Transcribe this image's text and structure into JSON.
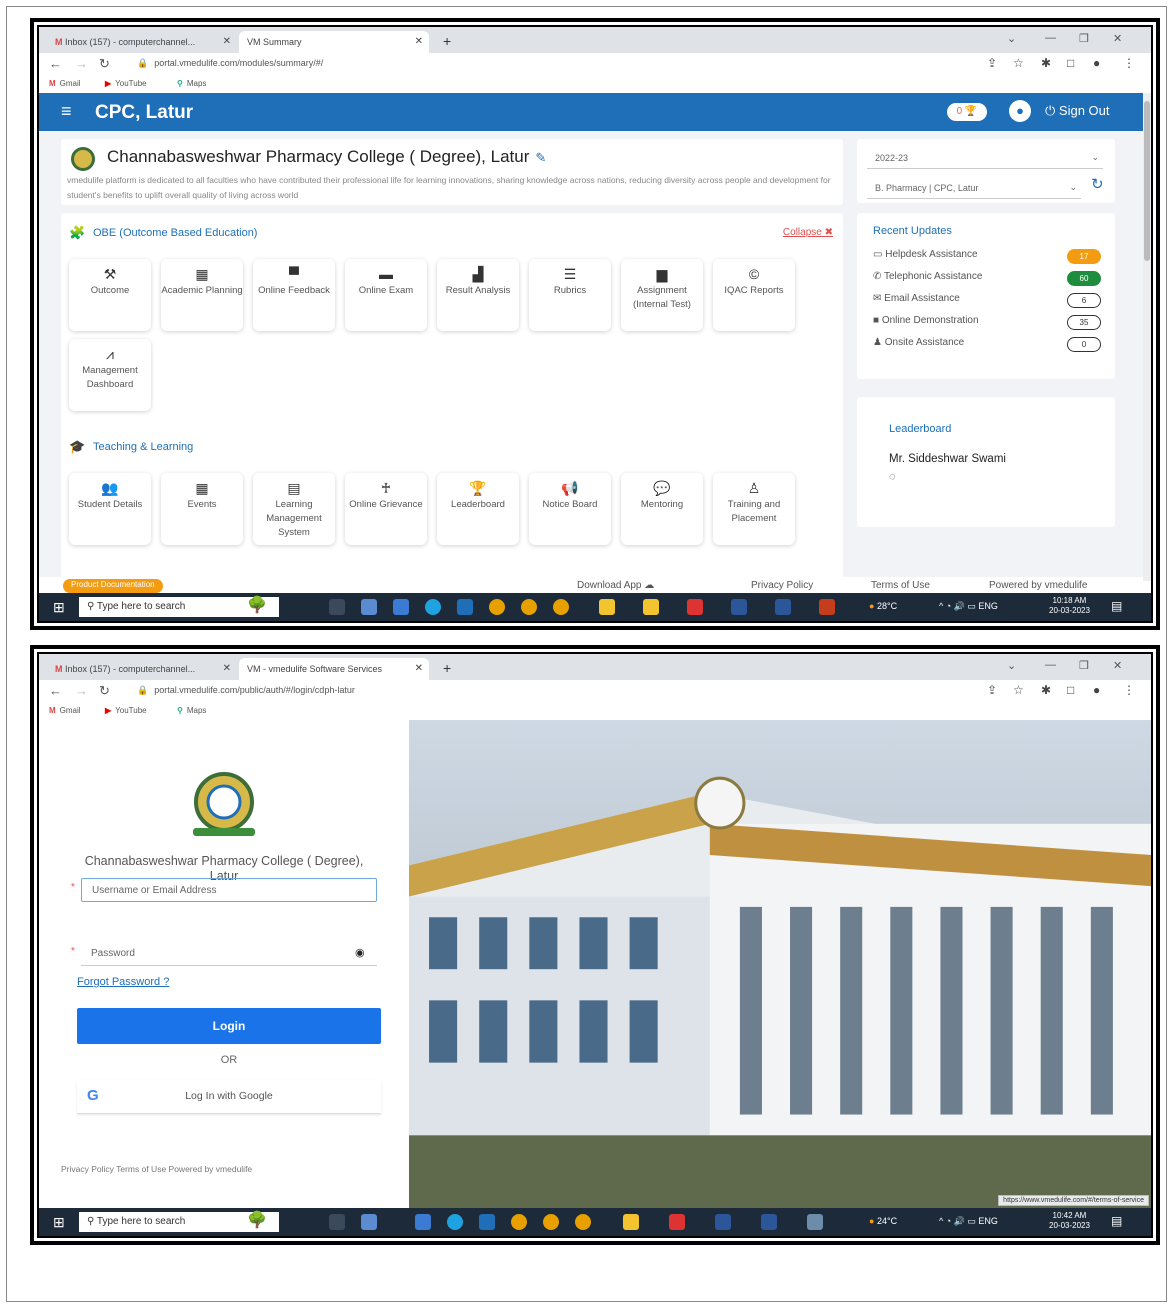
{
  "shot1": {
    "tabs": [
      {
        "label": "Inbox (157) - computerchannel..."
      },
      {
        "label": "VM Summary"
      }
    ],
    "url": "portal.vmedulife.com/modules/summary/#/",
    "bookmarks": [
      "Gmail",
      "YouTube",
      "Maps"
    ],
    "app_title": "CPC, Latur",
    "trophy_count": "0",
    "sign_out": "Sign Out",
    "college_name": "Channabasweshwar Pharmacy College ( Degree), Latur",
    "college_desc": "vmedulife platform is dedicated to all faculties who have contributed their professional life for learning innovations, sharing knowledge across nations, reducing diversity across people and development for student's benefits to uplift overall quality of living across world",
    "year_select": "2022-23",
    "program_select": "B. Pharmacy | CPC, Latur",
    "obe_title": "OBE (Outcome Based Education)",
    "collapse_label": "Collapse",
    "obe_tiles": [
      {
        "label": "Outcome",
        "icon": "wrench-icon"
      },
      {
        "label": "Academic Planning",
        "icon": "calendar-icon"
      },
      {
        "label": "Online Feedback",
        "icon": "chat-icon"
      },
      {
        "label": "Online Exam",
        "icon": "folder-icon"
      },
      {
        "label": "Result Analysis",
        "icon": "bar-chart-icon"
      },
      {
        "label": "Rubrics",
        "icon": "list-icon"
      },
      {
        "label": "Assignment (Internal Test)",
        "icon": "document-icon"
      },
      {
        "label": "IQAC Reports",
        "icon": "copyright-icon"
      },
      {
        "label": "Management Dashboard",
        "icon": "line-chart-icon"
      }
    ],
    "teaching_title": "Teaching & Learning",
    "teaching_tiles": [
      {
        "label": "Student Details",
        "icon": "users-icon"
      },
      {
        "label": "Events",
        "icon": "calendar-icon"
      },
      {
        "label": "Learning Management System",
        "icon": "book-icon"
      },
      {
        "label": "Online Grievance",
        "icon": "person-icon"
      },
      {
        "label": "Leaderboard",
        "icon": "trophy-icon"
      },
      {
        "label": "Notice Board",
        "icon": "megaphone-icon"
      },
      {
        "label": "Mentoring",
        "icon": "chat-icon"
      },
      {
        "label": "Training and Placement",
        "icon": "person-board-icon"
      }
    ],
    "updates_title": "Recent Updates",
    "updates": [
      {
        "label": "Helpdesk Assistance",
        "count": "17",
        "style": "orange"
      },
      {
        "label": "Telephonic Assistance",
        "count": "60",
        "style": "green"
      },
      {
        "label": "Email Assistance",
        "count": "6",
        "style": "outline"
      },
      {
        "label": "Online Demonstration",
        "count": "35",
        "style": "outline"
      },
      {
        "label": "Onsite Assistance",
        "count": "0",
        "style": "outline"
      }
    ],
    "leaderboard_title": "Leaderboard",
    "leaderboard_name": "Mr. Siddeshwar Swami",
    "footer": {
      "product_doc": "Product Documentation",
      "download": "Download App",
      "privacy": "Privacy Policy",
      "terms": "Terms of Use",
      "powered": "Powered by vmedulife"
    },
    "taskbar": {
      "search": "Type here to search",
      "weather": "28°C",
      "lang": "ENG",
      "time": "10:18 AM",
      "date": "20-03-2023"
    }
  },
  "shot2": {
    "tabs": [
      {
        "label": "Inbox (157) - computerchannel..."
      },
      {
        "label": "VM - vmedulife Software Services"
      }
    ],
    "url": "portal.vmedulife.com/public/auth/#/login/cdph-latur",
    "bookmarks": [
      "Gmail",
      "YouTube",
      "Maps"
    ],
    "college_name": "Channabasweshwar Pharmacy College ( Degree), Latur",
    "username_placeholder": "Username or Email Address",
    "password_placeholder": "Password",
    "forgot": "Forgot Password ?",
    "login": "Login",
    "or": "OR",
    "google": "Log In with Google",
    "footer": "Privacy Policy   Terms of Use   Powered by vmedulife",
    "status_url": "https://www.vmedulife.com/#/terms-of-service",
    "taskbar": {
      "search": "Type here to search",
      "weather": "24°C",
      "lang": "ENG",
      "time": "10:42 AM",
      "date": "20-03-2023"
    }
  },
  "colors": {
    "brand_blue": "#1e6fb8",
    "orange": "#f39c12",
    "green": "#1e8e3e"
  }
}
